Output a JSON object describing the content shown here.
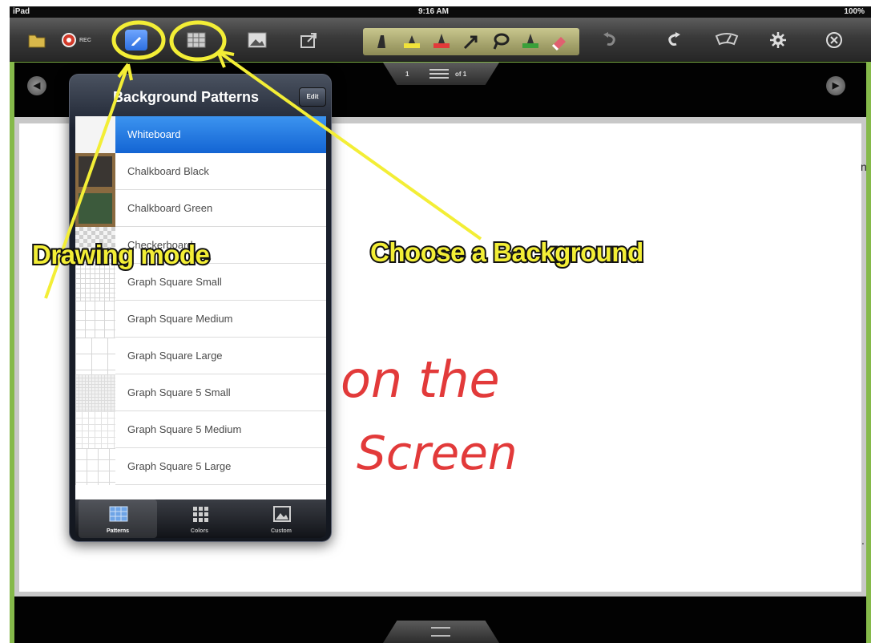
{
  "status_bar": {
    "device": "iPad",
    "time": "9:16 AM",
    "battery": "100%"
  },
  "toolbar": {
    "rec_label": "REC"
  },
  "page_indicator": {
    "current": "1",
    "total": "of 1"
  },
  "popover": {
    "title": "Background Patterns",
    "edit_label": "Edit",
    "items": [
      {
        "label": "Whiteboard",
        "selected": true
      },
      {
        "label": "Chalkboard Black"
      },
      {
        "label": "Chalkboard Green"
      },
      {
        "label": "Checkerboard"
      },
      {
        "label": "Graph Square Small"
      },
      {
        "label": "Graph Square Medium"
      },
      {
        "label": "Graph Square Large"
      },
      {
        "label": "Graph Square 5 Small"
      },
      {
        "label": "Graph Square 5 Medium"
      },
      {
        "label": "Graph Square 5 Large"
      }
    ],
    "tabs": [
      {
        "label": "Patterns",
        "icon": "patterns-icon",
        "active": true
      },
      {
        "label": "Colors",
        "icon": "grid-icon"
      },
      {
        "label": "Custom",
        "icon": "image-icon"
      }
    ]
  },
  "annotations": {
    "drawing_mode": "Drawing mode",
    "choose_background": "Choose a Background"
  },
  "handwriting": {
    "line1": "on the",
    "line2": "Screen"
  },
  "edge_fragments": {
    "top": "n",
    "bottom": "."
  },
  "colors": {
    "accent_blue": "#1f6fe0",
    "frame_green": "#85b94a",
    "callout_yellow": "#f3ee36",
    "ink_red": "#e23a3a"
  }
}
